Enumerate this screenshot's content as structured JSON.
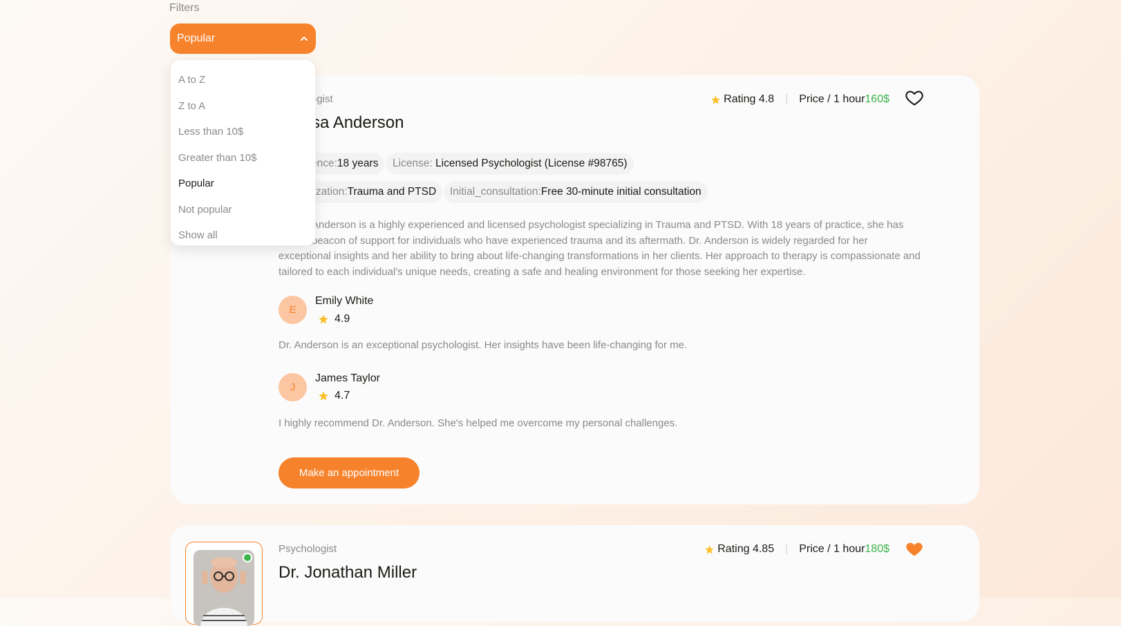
{
  "filters": {
    "label": "Filters",
    "selected": "Popular",
    "options": [
      "A to Z",
      "Z to A",
      "Less than 10$",
      "Greater than 10$",
      "Popular",
      "Not popular",
      "Show all"
    ],
    "active_option": "Popular"
  },
  "colors": {
    "accent": "#f7822c",
    "price": "#3ab54a",
    "star": "#fbc02d",
    "muted": "#8a8a89"
  },
  "cards": [
    {
      "role": "Psychologist",
      "name": "Dr. Sarah Anderson",
      "visible_role": "ogist",
      "visible_name": "sa Anderson",
      "rating_label": "Rating 4.8",
      "price_label": "Price / 1 hour",
      "price_value": "160$",
      "favorite": false,
      "tags": [
        {
          "key": "ence:",
          "value": "18 years"
        },
        {
          "key": "License: ",
          "value": "Licensed Psychologist (License #98765)"
        },
        {
          "key": "lization:",
          "value": "Trauma and PTSD"
        },
        {
          "key": "Initial_consultation:",
          "value": "Free 30-minute initial consultation"
        }
      ],
      "description_lines": [
        "Anderson is a highly experienced and licensed psychologist specializing in Trauma and PTSD. With 18 years of practice, she has",
        "beacon of support for individuals who have experienced trauma and its aftermath. Dr. Anderson is widely regarded for her",
        "exceptional insights and her ability to bring about life-changing transformations in her clients. Her approach to therapy is compassionate and",
        "tailored to each individual's unique needs, creating a safe and healing environment for those seeking her expertise."
      ],
      "reviews": [
        {
          "initial": "E",
          "name": "Emily White",
          "rating": "4.9",
          "text": "Dr. Anderson is an exceptional psychologist. Her insights have been life-changing for me."
        },
        {
          "initial": "J",
          "name": "James Taylor",
          "rating": "4.7",
          "text": "I highly recommend Dr. Anderson. She's helped me overcome my personal challenges."
        }
      ],
      "appointment_label": "Make an appointment"
    },
    {
      "role": "Psychologist",
      "name": "Dr. Jonathan Miller",
      "rating_label": "Rating 4.85",
      "price_label": "Price / 1 hour",
      "price_value": "180$",
      "favorite": true,
      "online": true
    }
  ]
}
